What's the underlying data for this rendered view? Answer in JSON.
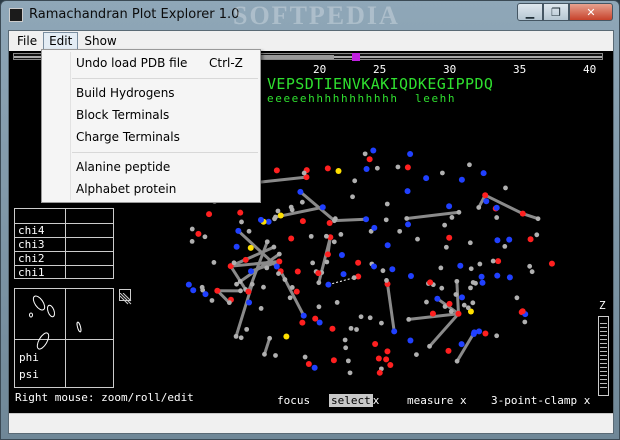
{
  "window": {
    "title": "Ramachandran Plot Explorer 1.0",
    "watermark": "SOFTPEDIA",
    "controls": {
      "minimize": "▁",
      "maximize": "❐",
      "close": "✕"
    }
  },
  "menubar": {
    "items": [
      "File",
      "Edit",
      "Show"
    ],
    "active": "Edit"
  },
  "edit_menu": {
    "groups": [
      [
        {
          "label": "Undo load PDB file",
          "shortcut": "Ctrl-Z"
        }
      ],
      [
        {
          "label": "Build Hydrogens"
        },
        {
          "label": "Block Terminals"
        },
        {
          "label": "Charge Terminals"
        }
      ],
      [
        {
          "label": "Alanine peptide"
        },
        {
          "label": "Alphabet protein"
        }
      ]
    ]
  },
  "ruler": {
    "ticks": [
      "20",
      "25",
      "30",
      "35",
      "40"
    ]
  },
  "sequence": "VEPSDTIENVKAKIQDKEGIPPDQ",
  "secondary_structure": "eeeeehhhhhhhhhhh  leehh",
  "chi_panel": {
    "rows": [
      "chi4",
      "chi3",
      "chi2",
      "chi1"
    ]
  },
  "rama_panel": {
    "labels": [
      "phi",
      "psi"
    ]
  },
  "hint": "Right mouse: zoom/roll/edit",
  "modes": {
    "focus": "focus",
    "select": "select",
    "measure": "measure",
    "clamp": "3-point-clamp",
    "close_mark": "x"
  },
  "zoom_label": "Z",
  "colors": {
    "canvas": "#000000",
    "sequence": "#2fe02f",
    "slider_handle": "#c020e0",
    "oxygen": "#ff2020",
    "nitrogen": "#2040ff",
    "carbon": "#b0b0b0",
    "sulfur": "#ffe000",
    "hbond": "#ffffff"
  }
}
